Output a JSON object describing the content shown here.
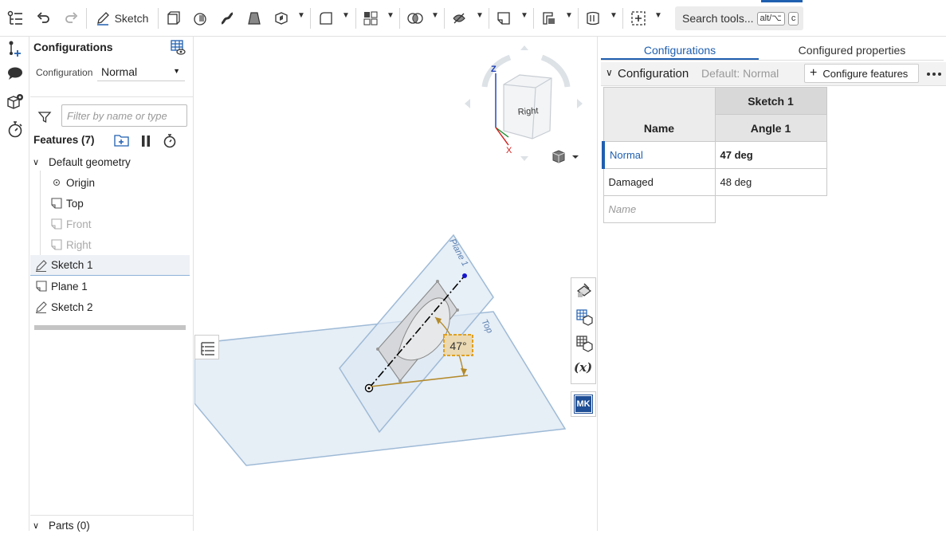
{
  "toolbar": {
    "sketch_label": "Sketch",
    "search_label": "Search tools...",
    "search_shortcut_1": "alt/⌥",
    "search_shortcut_2": "c"
  },
  "left_panel": {
    "title": "Configurations",
    "configuration_label": "Configuration",
    "configuration_value": "Normal",
    "filter_placeholder": "Filter by name or type",
    "features_title": "Features (7)",
    "default_geometry": "Default geometry",
    "tree": {
      "origin": "Origin",
      "top": "Top",
      "front": "Front",
      "right": "Right",
      "sketch1": "Sketch 1",
      "plane1": "Plane 1",
      "sketch2": "Sketch 2"
    },
    "parts_label": "Parts (0)"
  },
  "viewport": {
    "view_cube_face": "Right",
    "axis_z": "Z",
    "axis_x": "X",
    "plane_top_label": "Top",
    "plane1_label": "Plane 1",
    "dimension_value": "47°",
    "mk_badge": "MK"
  },
  "right_panel": {
    "tab_configurations": "Configurations",
    "tab_configured_properties": "Configured properties",
    "section_title": "Configuration",
    "section_default": "Default: Normal",
    "configure_features_button": "Configure features",
    "table": {
      "header_group": "Sketch 1",
      "name_header": "Name",
      "param_header": "Angle 1",
      "rows": [
        {
          "name": "Normal",
          "value": "47 deg"
        },
        {
          "name": "Damaged",
          "value": "48 deg"
        }
      ],
      "new_row_placeholder": "Name"
    }
  },
  "colors": {
    "accent": "#1f5fb0",
    "plane_fill": "#dde8f3",
    "plane_stroke": "#9ebad6",
    "dimension": "#b38a2a"
  }
}
